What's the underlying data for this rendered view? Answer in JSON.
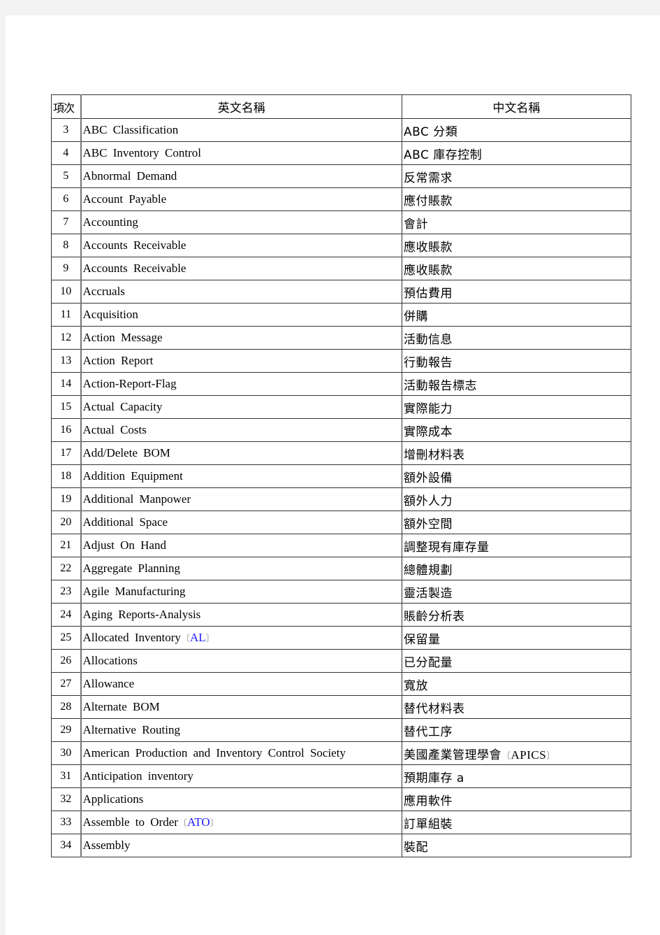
{
  "table": {
    "headers": {
      "no": "項次",
      "english": "英文名稱",
      "chinese": "中文名稱"
    },
    "rows": [
      {
        "no": "3",
        "en": "ABC Classification",
        "zh": "ABC 分類"
      },
      {
        "no": "4",
        "en": "ABC Inventory Control",
        "zh": "ABC 庫存控制"
      },
      {
        "no": "5",
        "en": "Abnormal Demand",
        "zh": "反常需求"
      },
      {
        "no": "6",
        "en": "Account Payable",
        "zh": "應付賬款"
      },
      {
        "no": "7",
        "en": "Accounting",
        "zh": "會計"
      },
      {
        "no": "8",
        "en": "Accounts Receivable",
        "zh": "應收賬款"
      },
      {
        "no": "9",
        "en": "Accounts Receivable",
        "zh": "應收賬款"
      },
      {
        "no": "10",
        "en": "Accruals",
        "zh": "預估費用"
      },
      {
        "no": "11",
        "en": "Acquisition",
        "zh": "併購"
      },
      {
        "no": "12",
        "en": "Action Message",
        "zh": "活動信息"
      },
      {
        "no": "13",
        "en": "Action Report",
        "zh": "行動報告"
      },
      {
        "no": "14",
        "en": "Action-Report-Flag",
        "zh": "活動報告標志"
      },
      {
        "no": "15",
        "en": "Actual Capacity",
        "zh": "實際能力"
      },
      {
        "no": "16",
        "en": "Actual Costs",
        "zh": "實際成本"
      },
      {
        "no": "17",
        "en": "Add/Delete BOM",
        "zh": "增刪材料表"
      },
      {
        "no": "18",
        "en": "Addition Equipment",
        "zh": "額外設備"
      },
      {
        "no": "19",
        "en": "Additional Manpower",
        "zh": "額外人力"
      },
      {
        "no": "20",
        "en": "Additional Space",
        "zh": "額外空間"
      },
      {
        "no": "21",
        "en": "Adjust On Hand",
        "zh": "調整現有庫存量"
      },
      {
        "no": "22",
        "en": "Aggregate Planning",
        "zh": "總體規劃"
      },
      {
        "no": "23",
        "en": "Agile Manufacturing",
        "zh": "靈活製造"
      },
      {
        "no": "24",
        "en": "Aging Reports-Analysis",
        "zh": "賬齡分析表"
      },
      {
        "no": "25",
        "en": "Allocated Inventory",
        "en_abbr": "AL",
        "zh": "保留量"
      },
      {
        "no": "26",
        "en": "Allocations",
        "zh": "已分配量"
      },
      {
        "no": "27",
        "en": "Allowance",
        "zh": "寬放"
      },
      {
        "no": "28",
        "en": "Alternate BOM",
        "zh": "替代材料表"
      },
      {
        "no": "29",
        "en": "Alternative Routing",
        "zh": "替代工序"
      },
      {
        "no": "30",
        "en": "American Production and Inventory Control Society",
        "zh": "美國產業管理學會",
        "zh_abbr": "APICS"
      },
      {
        "no": "31",
        "en": "Anticipation inventory",
        "zh": "預期庫存 a"
      },
      {
        "no": "32",
        "en": "Applications",
        "zh": "應用軟件"
      },
      {
        "no": "33",
        "en": "Assemble to Order",
        "en_abbr": "ATO",
        "zh": "訂單組裝"
      },
      {
        "no": "34",
        "en": "Assembly",
        "zh": "裝配"
      }
    ]
  },
  "colors": {
    "abbreviation": "#1a1aff",
    "bracket": "#999999",
    "page_background": "#ffffff",
    "viewer_background": "#f3f3f3"
  },
  "brackets": {
    "open": "〔",
    "close": "〕"
  }
}
